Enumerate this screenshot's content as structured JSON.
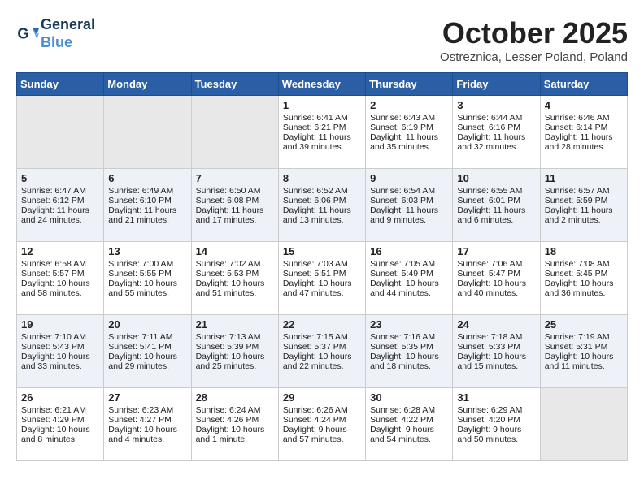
{
  "header": {
    "logo_line1": "General",
    "logo_line2": "Blue",
    "month": "October 2025",
    "location": "Ostreznica, Lesser Poland, Poland"
  },
  "days_of_week": [
    "Sunday",
    "Monday",
    "Tuesday",
    "Wednesday",
    "Thursday",
    "Friday",
    "Saturday"
  ],
  "weeks": [
    [
      {
        "day": "",
        "empty": true
      },
      {
        "day": "",
        "empty": true
      },
      {
        "day": "",
        "empty": true
      },
      {
        "day": "1",
        "sunrise": "6:41 AM",
        "sunset": "6:21 PM",
        "daylight": "11 hours and 39 minutes."
      },
      {
        "day": "2",
        "sunrise": "6:43 AM",
        "sunset": "6:19 PM",
        "daylight": "11 hours and 35 minutes."
      },
      {
        "day": "3",
        "sunrise": "6:44 AM",
        "sunset": "6:16 PM",
        "daylight": "11 hours and 32 minutes."
      },
      {
        "day": "4",
        "sunrise": "6:46 AM",
        "sunset": "6:14 PM",
        "daylight": "11 hours and 28 minutes."
      }
    ],
    [
      {
        "day": "5",
        "sunrise": "6:47 AM",
        "sunset": "6:12 PM",
        "daylight": "11 hours and 24 minutes."
      },
      {
        "day": "6",
        "sunrise": "6:49 AM",
        "sunset": "6:10 PM",
        "daylight": "11 hours and 21 minutes."
      },
      {
        "day": "7",
        "sunrise": "6:50 AM",
        "sunset": "6:08 PM",
        "daylight": "11 hours and 17 minutes."
      },
      {
        "day": "8",
        "sunrise": "6:52 AM",
        "sunset": "6:06 PM",
        "daylight": "11 hours and 13 minutes."
      },
      {
        "day": "9",
        "sunrise": "6:54 AM",
        "sunset": "6:03 PM",
        "daylight": "11 hours and 9 minutes."
      },
      {
        "day": "10",
        "sunrise": "6:55 AM",
        "sunset": "6:01 PM",
        "daylight": "11 hours and 6 minutes."
      },
      {
        "day": "11",
        "sunrise": "6:57 AM",
        "sunset": "5:59 PM",
        "daylight": "11 hours and 2 minutes."
      }
    ],
    [
      {
        "day": "12",
        "sunrise": "6:58 AM",
        "sunset": "5:57 PM",
        "daylight": "10 hours and 58 minutes."
      },
      {
        "day": "13",
        "sunrise": "7:00 AM",
        "sunset": "5:55 PM",
        "daylight": "10 hours and 55 minutes."
      },
      {
        "day": "14",
        "sunrise": "7:02 AM",
        "sunset": "5:53 PM",
        "daylight": "10 hours and 51 minutes."
      },
      {
        "day": "15",
        "sunrise": "7:03 AM",
        "sunset": "5:51 PM",
        "daylight": "10 hours and 47 minutes."
      },
      {
        "day": "16",
        "sunrise": "7:05 AM",
        "sunset": "5:49 PM",
        "daylight": "10 hours and 44 minutes."
      },
      {
        "day": "17",
        "sunrise": "7:06 AM",
        "sunset": "5:47 PM",
        "daylight": "10 hours and 40 minutes."
      },
      {
        "day": "18",
        "sunrise": "7:08 AM",
        "sunset": "5:45 PM",
        "daylight": "10 hours and 36 minutes."
      }
    ],
    [
      {
        "day": "19",
        "sunrise": "7:10 AM",
        "sunset": "5:43 PM",
        "daylight": "10 hours and 33 minutes."
      },
      {
        "day": "20",
        "sunrise": "7:11 AM",
        "sunset": "5:41 PM",
        "daylight": "10 hours and 29 minutes."
      },
      {
        "day": "21",
        "sunrise": "7:13 AM",
        "sunset": "5:39 PM",
        "daylight": "10 hours and 25 minutes."
      },
      {
        "day": "22",
        "sunrise": "7:15 AM",
        "sunset": "5:37 PM",
        "daylight": "10 hours and 22 minutes."
      },
      {
        "day": "23",
        "sunrise": "7:16 AM",
        "sunset": "5:35 PM",
        "daylight": "10 hours and 18 minutes."
      },
      {
        "day": "24",
        "sunrise": "7:18 AM",
        "sunset": "5:33 PM",
        "daylight": "10 hours and 15 minutes."
      },
      {
        "day": "25",
        "sunrise": "7:19 AM",
        "sunset": "5:31 PM",
        "daylight": "10 hours and 11 minutes."
      }
    ],
    [
      {
        "day": "26",
        "sunrise": "6:21 AM",
        "sunset": "4:29 PM",
        "daylight": "10 hours and 8 minutes."
      },
      {
        "day": "27",
        "sunrise": "6:23 AM",
        "sunset": "4:27 PM",
        "daylight": "10 hours and 4 minutes."
      },
      {
        "day": "28",
        "sunrise": "6:24 AM",
        "sunset": "4:26 PM",
        "daylight": "10 hours and 1 minute."
      },
      {
        "day": "29",
        "sunrise": "6:26 AM",
        "sunset": "4:24 PM",
        "daylight": "9 hours and 57 minutes."
      },
      {
        "day": "30",
        "sunrise": "6:28 AM",
        "sunset": "4:22 PM",
        "daylight": "9 hours and 54 minutes."
      },
      {
        "day": "31",
        "sunrise": "6:29 AM",
        "sunset": "4:20 PM",
        "daylight": "9 hours and 50 minutes."
      },
      {
        "day": "",
        "empty": true
      }
    ]
  ]
}
